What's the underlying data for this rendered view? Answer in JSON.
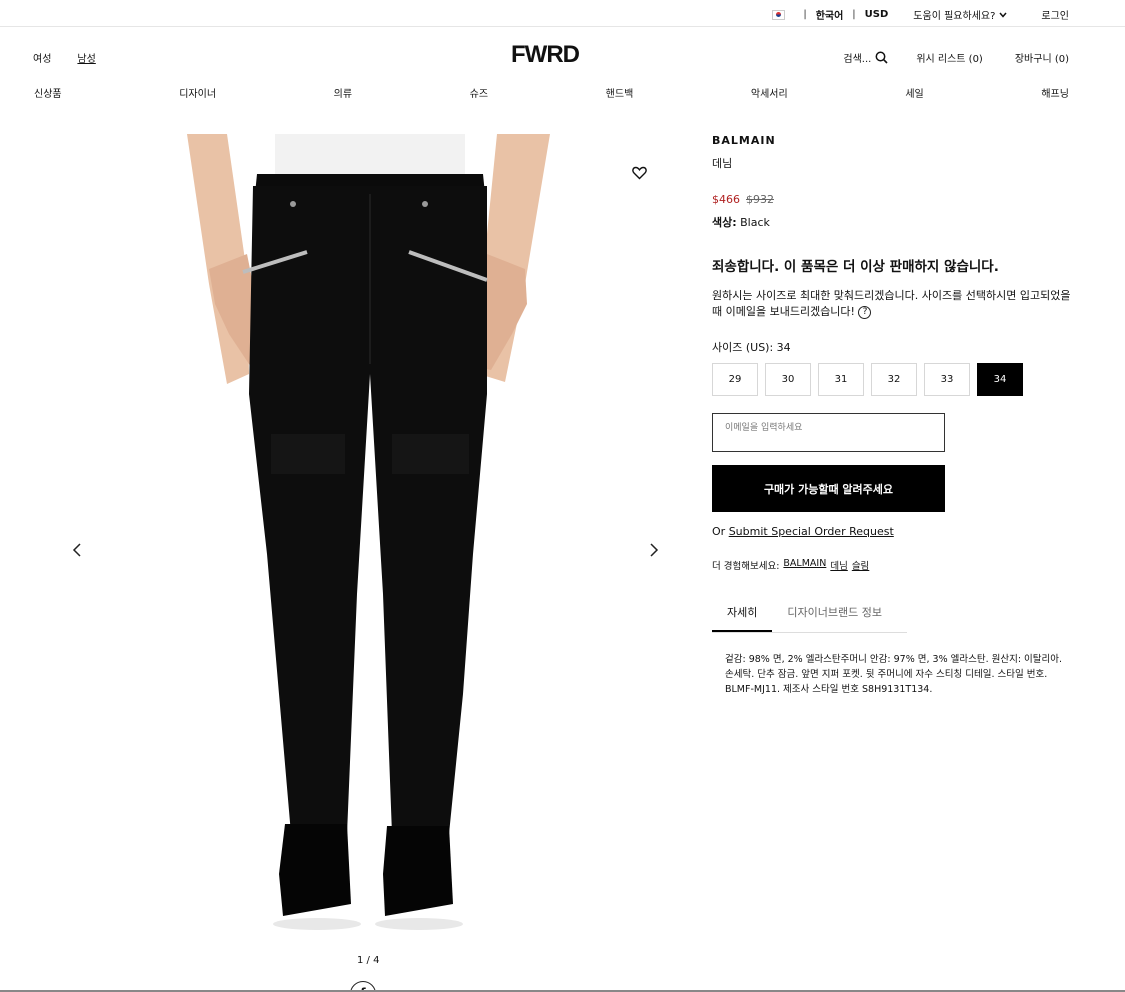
{
  "utility": {
    "language": "한국어",
    "currency": "USD",
    "help": "도움이 필요하세요?",
    "login": "로그인",
    "separator": "|"
  },
  "header": {
    "logo": "FWRD",
    "gender": [
      "여성",
      "남성"
    ],
    "search_label": "검색...",
    "wishlist": "위시 리스트 (0)",
    "bag": "장바구니 (0)"
  },
  "categories": [
    "신상품",
    "디자이너",
    "의류",
    "슈즈",
    "핸드백",
    "악세서리",
    "세일",
    "해프닝"
  ],
  "gallery": {
    "pager": "1 / 4",
    "prev_icon": "chevron-left-icon",
    "next_icon": "chevron-right-icon",
    "share_glyph": "f"
  },
  "product": {
    "brand": "BALMAIN",
    "type": "데님",
    "sale_price": "$466",
    "original_price": "$932",
    "color_label": "색상:",
    "color_value": "Black",
    "sold_out": "죄송합니다. 이 품목은 더 이상 판매하지 않습니다.",
    "notice": "원하시는 사이즈로 최대한 맞춰드리겠습니다. 사이즈를 선택하시면 입고되었을때 이메일을 보내드리겠습니다!",
    "size_label": "사이즈 (US): 34",
    "sizes": [
      "29",
      "30",
      "31",
      "32",
      "33",
      "34"
    ],
    "selected_size": "34",
    "email_placeholder": "이메일을 입력하세요",
    "notify_button": "구매가 가능할때 알려주세요",
    "special_prefix": "Or",
    "special_link": "Submit Special Order Request",
    "explore_prefix": "더 경험해보세요:",
    "explore_links": [
      "BALMAIN",
      "데님",
      "슬림"
    ],
    "tabs": [
      "자세히",
      "디자이너브랜드 정보"
    ],
    "details": "겉감: 98% 면, 2% 엘라스탄주머니 안감: 97% 면, 3% 엘라스탄. 원산지: 이탈리아. 손세탁. 단추 잠금. 앞면 지퍼 포켓. 뒷 주머니에 자수 스티칭 디테일. 스타일 번호. BLMF-MJ11. 제조사 스타일 번호 S8H9131T134."
  }
}
